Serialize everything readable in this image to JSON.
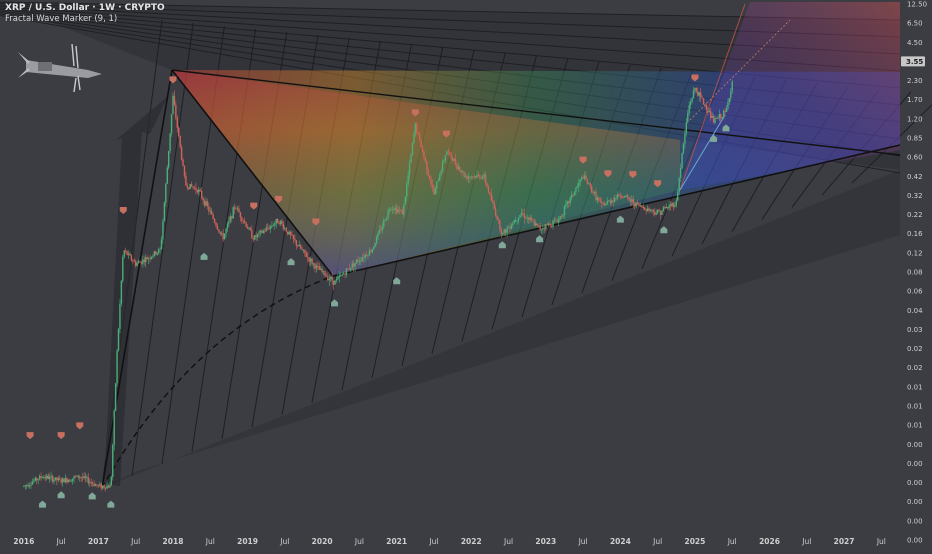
{
  "header": {
    "symbol_title": "XRP / U.S. Dollar · 1W · CRYPTO",
    "indicator": "Fractal Wave Marker (9, 1)"
  },
  "icons": {
    "logo": "missile-icon"
  },
  "colors": {
    "background": "#3b3d43",
    "up_candle": "#4caf78",
    "down_candle": "#d2635a",
    "marker_top": "#c8705f",
    "marker_bottom": "#7fa898",
    "price_tag_bg": "#c8c8c8"
  },
  "chart_data": {
    "type": "line",
    "scale": "log",
    "title": "XRP / U.S. Dollar · 1W · CRYPTO",
    "xlabel": "",
    "ylabel": "",
    "y_ticks": [
      "12.50",
      "6.50",
      "4.50",
      "3.55",
      "2.30",
      "1.70",
      "1.20",
      "0.85",
      "0.60",
      "0.42",
      "0.32",
      "0.22",
      "0.16",
      "0.12",
      "0.08",
      "0.06",
      "0.04",
      "0.03",
      "0.02",
      "0.02",
      "0.01",
      "0.01",
      "0.01",
      "0.00",
      "0.00",
      "0.00",
      "0.00",
      "0.00",
      "0.00"
    ],
    "x_ticks": [
      "2016",
      "Jul",
      "2017",
      "Jul",
      "2018",
      "Jul",
      "2019",
      "Jul",
      "2020",
      "Jul",
      "2021",
      "Jul",
      "2022",
      "Jul",
      "2023",
      "Jul",
      "2024",
      "Jul",
      "2025",
      "Jul",
      "2026",
      "Jul",
      "2027",
      "Jul"
    ],
    "current_price": "3.55",
    "series": [
      {
        "values": [
          {
            "x": "2016-01",
            "y": 0.006
          },
          {
            "x": "2016-04",
            "y": 0.007
          },
          {
            "x": "2016-07",
            "y": 0.0065
          },
          {
            "x": "2016-10",
            "y": 0.007
          },
          {
            "x": "2017-01",
            "y": 0.006
          },
          {
            "x": "2017-03",
            "y": 0.006
          },
          {
            "x": "2017-04",
            "y": 0.05
          },
          {
            "x": "2017-05",
            "y": 0.25
          },
          {
            "x": "2017-07",
            "y": 0.2
          },
          {
            "x": "2017-09",
            "y": 0.22
          },
          {
            "x": "2017-11",
            "y": 0.25
          },
          {
            "x": "2018-01",
            "y": 2.8
          },
          {
            "x": "2018-03",
            "y": 0.7
          },
          {
            "x": "2018-05",
            "y": 0.65
          },
          {
            "x": "2018-07",
            "y": 0.45
          },
          {
            "x": "2018-09",
            "y": 0.3
          },
          {
            "x": "2018-11",
            "y": 0.5
          },
          {
            "x": "2019-02",
            "y": 0.3
          },
          {
            "x": "2019-06",
            "y": 0.4
          },
          {
            "x": "2019-09",
            "y": 0.27
          },
          {
            "x": "2019-12",
            "y": 0.19
          },
          {
            "x": "2020-03",
            "y": 0.15
          },
          {
            "x": "2020-06",
            "y": 0.2
          },
          {
            "x": "2020-09",
            "y": 0.25
          },
          {
            "x": "2020-12",
            "y": 0.5
          },
          {
            "x": "2021-02",
            "y": 0.45
          },
          {
            "x": "2021-04",
            "y": 1.8
          },
          {
            "x": "2021-07",
            "y": 0.6
          },
          {
            "x": "2021-09",
            "y": 1.2
          },
          {
            "x": "2021-12",
            "y": 0.8
          },
          {
            "x": "2022-03",
            "y": 0.8
          },
          {
            "x": "2022-06",
            "y": 0.32
          },
          {
            "x": "2022-09",
            "y": 0.45
          },
          {
            "x": "2022-12",
            "y": 0.35
          },
          {
            "x": "2023-03",
            "y": 0.4
          },
          {
            "x": "2023-07",
            "y": 0.8
          },
          {
            "x": "2023-10",
            "y": 0.5
          },
          {
            "x": "2024-01",
            "y": 0.6
          },
          {
            "x": "2024-04",
            "y": 0.5
          },
          {
            "x": "2024-07",
            "y": 0.45
          },
          {
            "x": "2024-10",
            "y": 0.53
          },
          {
            "x": "2024-11",
            "y": 1.2
          },
          {
            "x": "2024-12",
            "y": 2.4
          },
          {
            "x": "2025-01",
            "y": 3.2
          },
          {
            "x": "2025-03",
            "y": 2.3
          },
          {
            "x": "2025-04",
            "y": 1.9
          },
          {
            "x": "2025-06",
            "y": 2.2
          },
          {
            "x": "2025-07",
            "y": 3.55
          }
        ]
      }
    ],
    "fractal_highs": [
      {
        "x": "2016-02",
        "y": 0.012
      },
      {
        "x": "2016-07",
        "y": 0.012
      },
      {
        "x": "2016-10",
        "y": 0.014
      },
      {
        "x": "2017-05",
        "y": 0.42
      },
      {
        "x": "2018-01",
        "y": 3.3
      },
      {
        "x": "2019-02",
        "y": 0.45
      },
      {
        "x": "2019-06",
        "y": 0.5
      },
      {
        "x": "2019-12",
        "y": 0.35
      },
      {
        "x": "2021-04",
        "y": 1.96
      },
      {
        "x": "2021-09",
        "y": 1.4
      },
      {
        "x": "2023-07",
        "y": 0.93
      },
      {
        "x": "2023-11",
        "y": 0.75
      },
      {
        "x": "2024-03",
        "y": 0.74
      },
      {
        "x": "2024-07",
        "y": 0.64
      },
      {
        "x": "2025-01",
        "y": 3.4
      }
    ],
    "fractal_lows": [
      {
        "x": "2016-04",
        "y": 0.005
      },
      {
        "x": "2016-07",
        "y": 0.0058
      },
      {
        "x": "2016-12",
        "y": 0.0057
      },
      {
        "x": "2017-03",
        "y": 0.005
      },
      {
        "x": "2018-06",
        "y": 0.25
      },
      {
        "x": "2019-08",
        "y": 0.23
      },
      {
        "x": "2020-03",
        "y": 0.12
      },
      {
        "x": "2021-01",
        "y": 0.17
      },
      {
        "x": "2022-06",
        "y": 0.3
      },
      {
        "x": "2022-12",
        "y": 0.33
      },
      {
        "x": "2024-01",
        "y": 0.45
      },
      {
        "x": "2024-08",
        "y": 0.38
      },
      {
        "x": "2025-04",
        "y": 1.61
      },
      {
        "x": "2025-06",
        "y": 1.9
      }
    ]
  }
}
